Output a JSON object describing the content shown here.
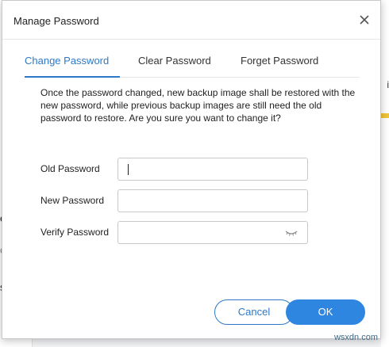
{
  "dialog": {
    "title": "Manage Password",
    "close_icon": "close-icon"
  },
  "tabs": [
    {
      "label": "Change Password",
      "active": true
    },
    {
      "label": "Clear Password",
      "active": false
    },
    {
      "label": "Forget Password",
      "active": false
    }
  ],
  "description": "Once the password changed, new backup image shall be restored with the new password, while previous backup images are still need the old password to restore. Are you sure you want to change it?",
  "fields": {
    "old_password": {
      "label": "Old Password",
      "value": ""
    },
    "new_password": {
      "label": "New Password",
      "value": ""
    },
    "verify_password": {
      "label": "Verify Password",
      "value": "",
      "icon": "eye-hidden-icon"
    }
  },
  "buttons": {
    "cancel_label": "Cancel",
    "ok_label": "OK"
  },
  "background": {
    "fragments": [
      "en",
      "c",
      "se"
    ],
    "right_fragment": "i"
  },
  "watermark": "wsxdn.com",
  "colors": {
    "accent": "#2d79c7",
    "ok_button": "#2f86e0"
  }
}
